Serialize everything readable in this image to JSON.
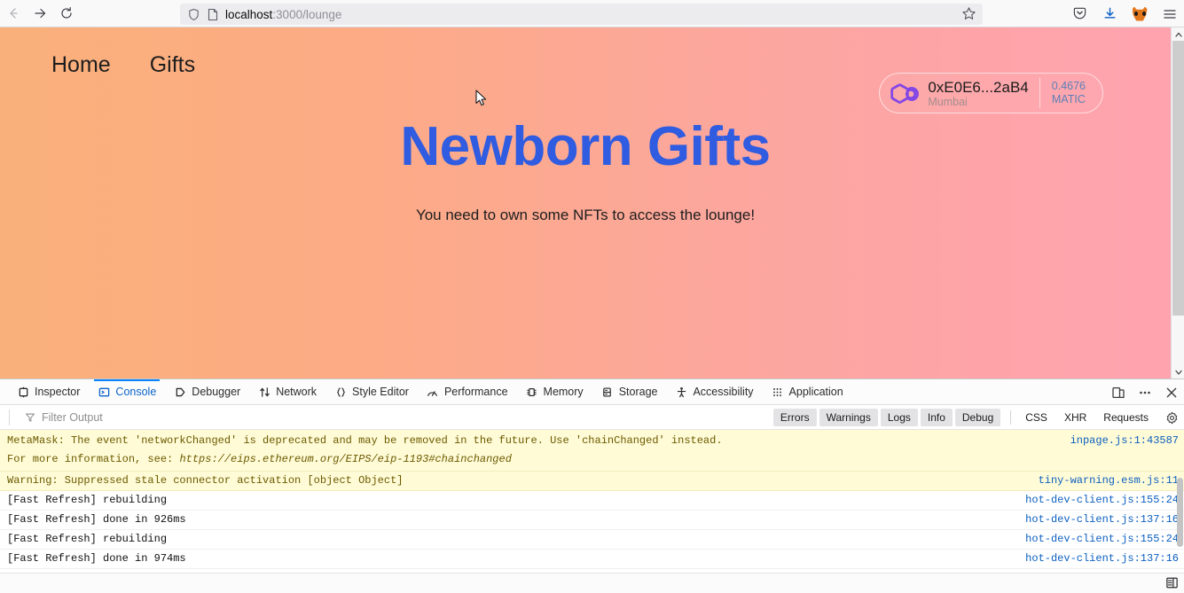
{
  "browser": {
    "back_icon": "back-arrow-icon",
    "forward_icon": "forward-arrow-icon",
    "reload_icon": "reload-icon",
    "shield_icon": "shield-icon",
    "page_icon": "page-doc-icon",
    "url_host": "localhost",
    "url_path": ":3000/lounge",
    "bookmark_icon": "star-icon",
    "pocket_icon": "pocket-icon",
    "downloads_icon": "download-icon",
    "extension_icon": "metamask-fox-icon",
    "menu_icon": "hamburger-menu-icon"
  },
  "page": {
    "nav": [
      {
        "label": "Home"
      },
      {
        "label": "Gifts"
      }
    ],
    "wallet": {
      "logo_icon": "polygon-logo-icon",
      "address": "0xE0E6...2aB4",
      "network": "Mumbai",
      "balance": "0.4676",
      "currency": "MATIC"
    },
    "hero": {
      "title": "Newborn Gifts",
      "subtitle": "You need to own some NFTs to access the lounge!"
    },
    "colors": {
      "gradient_start": "#fab07a",
      "gradient_end": "#ffa3b0",
      "heading": "#2f5ce0",
      "polygon_purple": "#8247e5"
    }
  },
  "devtools": {
    "tabs": [
      {
        "label": "Inspector",
        "icon": "inspector-icon",
        "active": false
      },
      {
        "label": "Console",
        "icon": "console-icon",
        "active": true
      },
      {
        "label": "Debugger",
        "icon": "debugger-icon",
        "active": false
      },
      {
        "label": "Network",
        "icon": "network-icon",
        "active": false
      },
      {
        "label": "Style Editor",
        "icon": "style-editor-icon",
        "active": false
      },
      {
        "label": "Performance",
        "icon": "performance-icon",
        "active": false
      },
      {
        "label": "Memory",
        "icon": "memory-icon",
        "active": false
      },
      {
        "label": "Storage",
        "icon": "storage-icon",
        "active": false
      },
      {
        "label": "Accessibility",
        "icon": "accessibility-icon",
        "active": false
      },
      {
        "label": "Application",
        "icon": "application-icon",
        "active": false
      }
    ],
    "toolbar_right": {
      "responsive_icon": "responsive-design-mode-icon",
      "meatball_icon": "more-options-icon",
      "close_icon": "close-icon"
    },
    "filter": {
      "icon": "filter-funnel-icon",
      "placeholder": "Filter Output",
      "value": ""
    },
    "filter_buttons": [
      {
        "label": "Errors",
        "active": true
      },
      {
        "label": "Warnings",
        "active": true
      },
      {
        "label": "Logs",
        "active": true
      },
      {
        "label": "Info",
        "active": true
      },
      {
        "label": "Debug",
        "active": true
      }
    ],
    "request_filters": [
      {
        "label": "CSS",
        "active": false
      },
      {
        "label": "XHR",
        "active": false
      },
      {
        "label": "Requests",
        "active": false
      }
    ],
    "settings_icon": "gear-icon",
    "messages": [
      {
        "type": "warn",
        "text_line1": "MetaMask: The event 'networkChanged' is deprecated and may be removed in the future. Use 'chainChanged' instead.",
        "text_line2_prefix": "For more information, see: ",
        "link": "https://eips.ethereum.org/EIPS/eip-1193#chainchanged",
        "source": "inpage.js:1:43587"
      },
      {
        "type": "warn",
        "text_line1": "Warning: Suppressed stale connector activation [object Object]",
        "text_line2_prefix": "",
        "link": "",
        "source": "tiny-warning.esm.js:11"
      },
      {
        "type": "log",
        "text_line1": "[Fast Refresh] rebuilding",
        "text_line2_prefix": "",
        "link": "",
        "source": "hot-dev-client.js:155:24"
      },
      {
        "type": "log",
        "text_line1": "[Fast Refresh] done in 926ms",
        "text_line2_prefix": "",
        "link": "",
        "source": "hot-dev-client.js:137:16"
      },
      {
        "type": "log",
        "text_line1": "[Fast Refresh] rebuilding",
        "text_line2_prefix": "",
        "link": "",
        "source": "hot-dev-client.js:155:24"
      },
      {
        "type": "log",
        "text_line1": "[Fast Refresh] done in 974ms",
        "text_line2_prefix": "",
        "link": "",
        "source": "hot-dev-client.js:137:16"
      }
    ],
    "footer_icon": "split-console-icon"
  }
}
